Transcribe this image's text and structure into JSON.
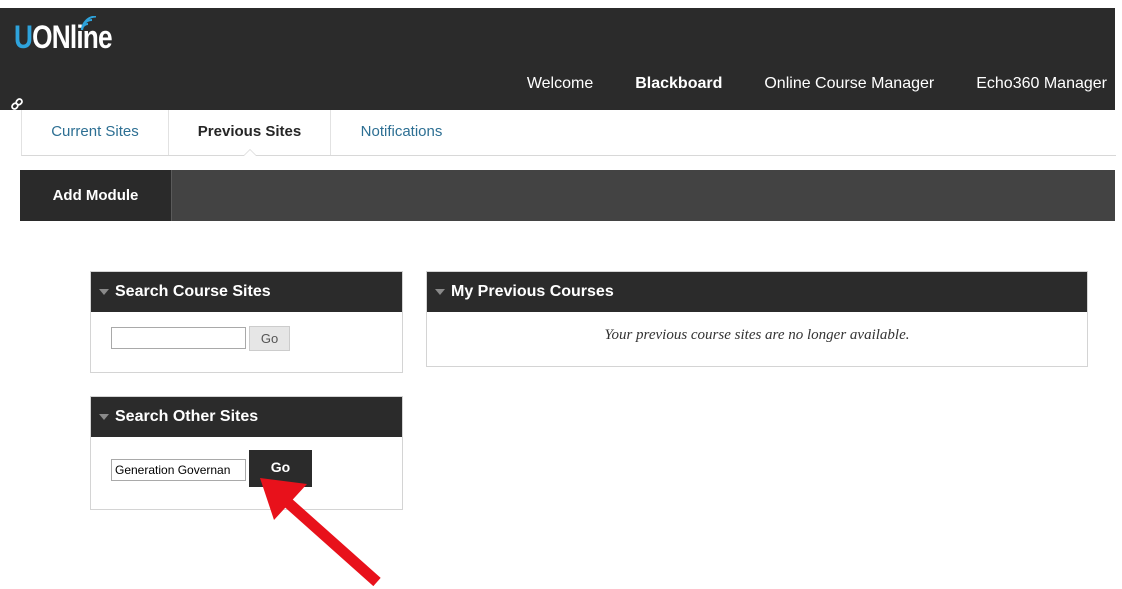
{
  "brand": {
    "logo_prefix": "U",
    "logo_rest": "ONline",
    "accent_color": "#2ea3dc"
  },
  "main_nav": {
    "items": [
      {
        "label": "Welcome"
      },
      {
        "label": "Blackboard"
      },
      {
        "label": "Online Course Manager"
      },
      {
        "label": "Echo360 Manager"
      }
    ],
    "active": "Blackboard"
  },
  "sub_tabs": {
    "items": [
      {
        "label": "Current Sites"
      },
      {
        "label": "Previous Sites"
      },
      {
        "label": "Notifications"
      }
    ],
    "active": "Previous Sites"
  },
  "action_bar": {
    "add_module_label": "Add Module"
  },
  "modules": {
    "search_course_sites": {
      "title": "Search Course Sites",
      "input_value": "",
      "go_label": "Go"
    },
    "search_other_sites": {
      "title": "Search Other Sites",
      "input_value": "Generation Governan",
      "go_label": "Go"
    },
    "my_previous_courses": {
      "title": "My Previous Courses",
      "message": "Your previous course sites are no longer available."
    }
  },
  "annotation": {
    "arrow_color": "#e8111b",
    "icon": "red-arrow-icon"
  }
}
